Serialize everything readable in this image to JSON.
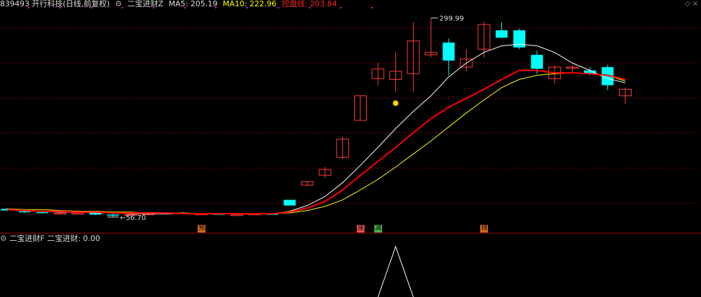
{
  "header": {
    "code_name": "839493 开行科技(日线,前复权)",
    "indicator_label": "二宝进财Z",
    "ma5": "MA5: 205.19",
    "ma10": "MA10: 222.96",
    "ctrl": "控盘线: 203.84"
  },
  "sub_header": {
    "indicator_label": "二宝进财F",
    "value_text": "二宝进财: 0.00"
  },
  "colors": {
    "up": "#ff3b3b",
    "down": "#00ffff",
    "ma5": "#ffffff",
    "ma10": "#ffff00",
    "ctrl": "#ff0000",
    "grid": "#7a0000"
  },
  "chart_data": [
    {
      "type": "candlestick",
      "title": "",
      "high_label": "299.99",
      "low_label": "56.70",
      "y_range_price": [
        50,
        310
      ],
      "candles": [
        {
          "o": 67,
          "h": 68,
          "l": 64,
          "c": 65
        },
        {
          "o": 64,
          "h": 66,
          "l": 62,
          "c": 63
        },
        {
          "o": 63,
          "h": 64,
          "l": 61,
          "c": 62
        },
        {
          "o": 62,
          "h": 63,
          "l": 61,
          "c": 62
        },
        {
          "o": 62,
          "h": 63,
          "l": 61,
          "c": 62
        },
        {
          "o": 62,
          "h": 62,
          "l": 59,
          "c": 60
        },
        {
          "o": 60,
          "h": 61,
          "l": 57,
          "c": 59
        },
        {
          "o": 59,
          "h": 61,
          "l": 58,
          "c": 60
        },
        {
          "o": 60,
          "h": 61,
          "l": 59,
          "c": 61
        },
        {
          "o": 61,
          "h": 62,
          "l": 60,
          "c": 62
        },
        {
          "o": 62,
          "h": 63,
          "l": 61,
          "c": 61
        },
        {
          "o": 61,
          "h": 62,
          "l": 60,
          "c": 61
        },
        {
          "o": 61,
          "h": 62,
          "l": 60,
          "c": 60
        },
        {
          "o": 60,
          "h": 61,
          "l": 59,
          "c": 60
        },
        {
          "o": 60,
          "h": 61,
          "l": 59,
          "c": 61
        },
        {
          "o": 61,
          "h": 61,
          "l": 60,
          "c": 60
        },
        {
          "o": 78,
          "h": 78,
          "l": 71,
          "c": 71
        },
        {
          "o": 96,
          "h": 100,
          "l": 95,
          "c": 100
        },
        {
          "o": 108,
          "h": 118,
          "l": 105,
          "c": 115
        },
        {
          "o": 130,
          "h": 155,
          "l": 128,
          "c": 152
        },
        {
          "o": 175,
          "h": 205,
          "l": 175,
          "c": 205
        },
        {
          "o": 226,
          "h": 245,
          "l": 218,
          "c": 238
        },
        {
          "o": 225,
          "h": 258,
          "l": 210,
          "c": 235
        },
        {
          "o": 232,
          "h": 295,
          "l": 210,
          "c": 272
        },
        {
          "o": 255,
          "h": 300,
          "l": 252,
          "c": 258
        },
        {
          "o": 270,
          "h": 275,
          "l": 230,
          "c": 248
        },
        {
          "o": 240,
          "h": 262,
          "l": 235,
          "c": 250
        },
        {
          "o": 262,
          "h": 295,
          "l": 252,
          "c": 292
        },
        {
          "o": 285,
          "h": 295,
          "l": 275,
          "c": 276
        },
        {
          "o": 285,
          "h": 287,
          "l": 262,
          "c": 264
        },
        {
          "o": 255,
          "h": 260,
          "l": 232,
          "c": 238
        },
        {
          "o": 226,
          "h": 242,
          "l": 220,
          "c": 240
        },
        {
          "o": 240,
          "h": 242,
          "l": 233,
          "c": 240
        },
        {
          "o": 236,
          "h": 240,
          "l": 230,
          "c": 232
        },
        {
          "o": 240,
          "h": 243,
          "l": 212,
          "c": 218
        },
        {
          "o": 205,
          "h": 215,
          "l": 195,
          "c": 213
        }
      ],
      "ma5": [
        66,
        65,
        64,
        63,
        63,
        62,
        62,
        61,
        61,
        61,
        61,
        61,
        61,
        61,
        61,
        61,
        64,
        71,
        82,
        99,
        120,
        142,
        165,
        186,
        205,
        228,
        245,
        258,
        266,
        268,
        266,
        258,
        245,
        236,
        226,
        221
      ],
      "ma10": [
        67,
        66,
        66,
        65,
        64,
        64,
        63,
        63,
        62,
        62,
        62,
        61,
        61,
        61,
        61,
        61,
        62,
        65,
        70,
        78,
        90,
        103,
        118,
        134,
        150,
        167,
        184,
        200,
        215,
        225,
        230,
        232,
        233,
        232,
        230,
        223
      ],
      "ctrl": [
        66,
        65,
        64,
        64,
        63,
        63,
        62,
        62,
        62,
        62,
        61,
        61,
        61,
        61,
        61,
        61,
        63,
        68,
        76,
        90,
        108,
        125,
        142,
        160,
        177,
        191,
        202,
        213,
        225,
        236,
        236,
        233,
        233,
        232,
        230,
        225
      ],
      "yellow_dot_index": 22,
      "yellow_dot_price": 196,
      "signals": [
        {
          "index": 11,
          "label": "预",
          "color": "#d2691e"
        },
        {
          "index": 20,
          "label": "涨",
          "color": "#e05050"
        },
        {
          "index": 21,
          "label": "减",
          "color": "#4fb04f"
        },
        {
          "index": 27,
          "label": "持",
          "color": "#d2691e"
        }
      ]
    },
    {
      "type": "line",
      "title": "",
      "series": [
        {
          "name": "二宝进财",
          "points": [
            [
              21,
              0
            ],
            [
              22,
              1
            ],
            [
              23,
              0
            ]
          ]
        }
      ],
      "value": 0.0
    }
  ]
}
